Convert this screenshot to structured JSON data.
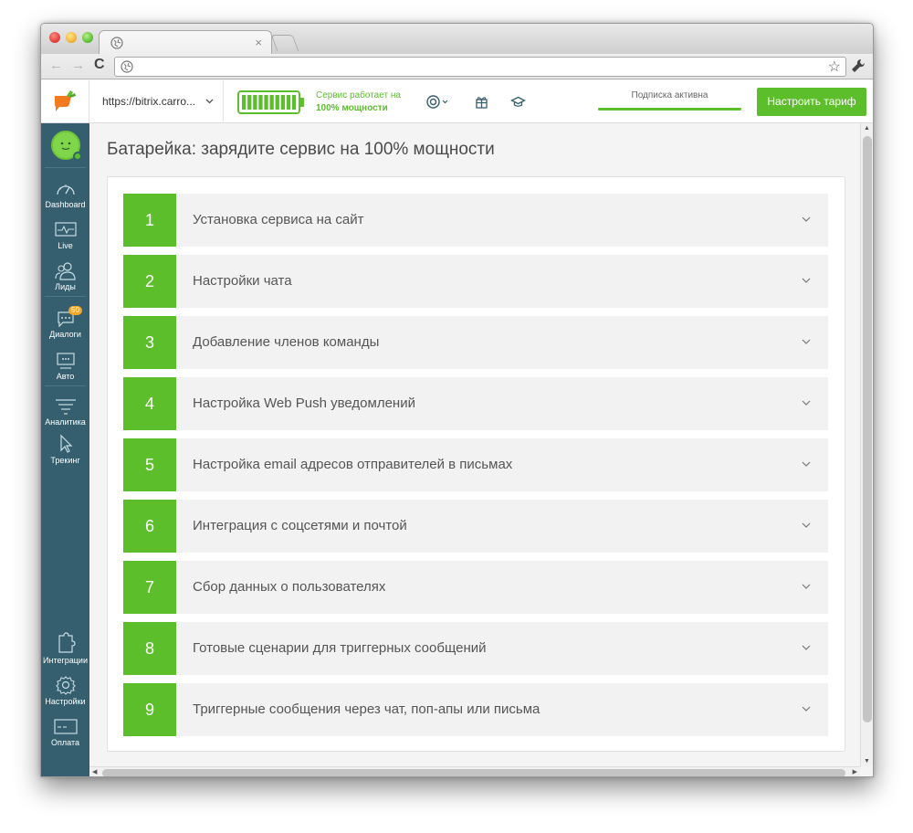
{
  "browser": {
    "tab_close": "×",
    "back": "←",
    "forward": "→",
    "reload": "C",
    "star": "☆"
  },
  "header": {
    "site_url": "https://bitrix.carro...",
    "service_status_line1": "Сервис работает на",
    "service_status_line2": "100% мощности",
    "subscription_label": "Подписка активна",
    "tariff_button": "Настроить тариф",
    "battery_level_percent": 100
  },
  "sidebar": {
    "items": [
      {
        "label": "Dashboard",
        "icon": "speedometer-icon"
      },
      {
        "label": "Live",
        "icon": "monitor-pulse-icon"
      },
      {
        "label": "Лиды",
        "icon": "users-icon"
      },
      {
        "label": "Диалоги",
        "icon": "chat-icon",
        "badge": "50"
      },
      {
        "label": "Авто",
        "icon": "auto-message-icon"
      },
      {
        "label": "Аналитика",
        "icon": "analytics-icon"
      },
      {
        "label": "Трекинг",
        "icon": "cursor-icon"
      },
      {
        "label": "Интеграции",
        "icon": "puzzle-icon"
      },
      {
        "label": "Настройки",
        "icon": "gear-icon"
      },
      {
        "label": "Оплата",
        "icon": "card-icon"
      }
    ]
  },
  "main": {
    "title": "Батарейка: зарядите сервис на 100% мощности",
    "steps": [
      {
        "num": "1",
        "label": "Установка сервиса на сайт"
      },
      {
        "num": "2",
        "label": "Настройки чата"
      },
      {
        "num": "3",
        "label": "Добавление членов команды"
      },
      {
        "num": "4",
        "label": "Настройка Web Push уведомлений"
      },
      {
        "num": "5",
        "label": "Настройка email адресов отправителей в письмах"
      },
      {
        "num": "6",
        "label": "Интеграция с соцсетями и почтой"
      },
      {
        "num": "7",
        "label": "Сбор данных о пользователях"
      },
      {
        "num": "8",
        "label": "Готовые сценарии для триггерных сообщений"
      },
      {
        "num": "9",
        "label": "Триггерные сообщения через чат, поп-апы или письма"
      }
    ]
  },
  "colors": {
    "accent": "#5dbe2b",
    "sidebar": "#355f6e"
  }
}
